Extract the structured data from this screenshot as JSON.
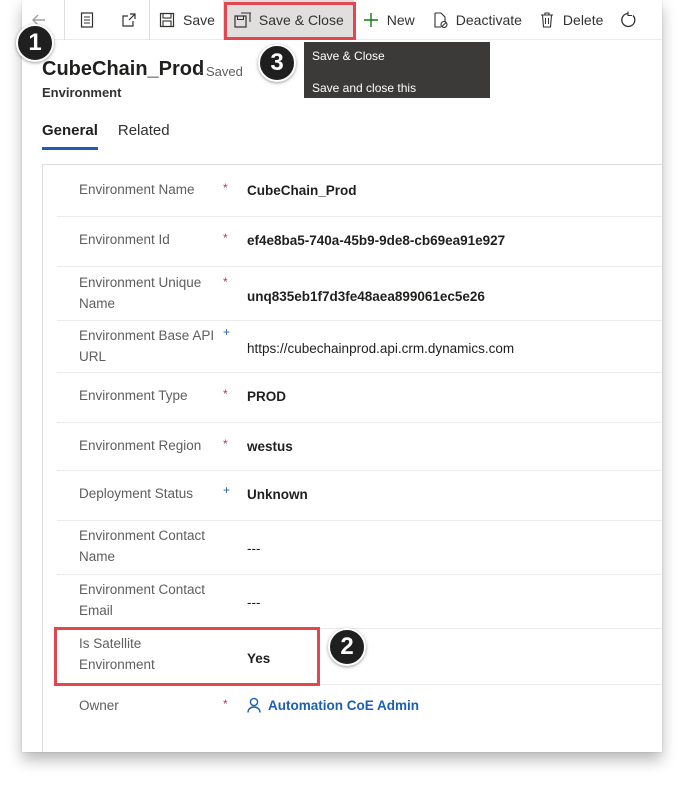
{
  "toolbar": {
    "save_label": "Save",
    "save_close_label": "Save & Close",
    "new_label": "New",
    "deactivate_label": "Deactivate",
    "delete_label": "Delete"
  },
  "record": {
    "title": "CubeChain_Prod",
    "saved_status": "- Saved",
    "entity": "Environment"
  },
  "tabs": [
    {
      "label": "General",
      "active": true
    },
    {
      "label": "Related",
      "active": false
    }
  ],
  "fields": [
    {
      "label": "Environment Name",
      "marker": "*",
      "value": "CubeChain_Prod"
    },
    {
      "label": "Environment Id",
      "marker": "*",
      "value": "ef4e8ba5-740a-45b9-9de8-cb69ea91e927"
    },
    {
      "label": "Environment Unique Name",
      "marker": "*",
      "value": "unq835eb1f7d3fe48aea899061ec5e26"
    },
    {
      "label": "Environment Base API URL",
      "marker": "+",
      "value": "https://cubechainprod.api.crm.dynamics.com"
    },
    {
      "label": "Environment Type",
      "marker": "*",
      "value": "PROD"
    },
    {
      "label": "Environment Region",
      "marker": "*",
      "value": "westus"
    },
    {
      "label": "Deployment Status",
      "marker": "+",
      "value": "Unknown"
    },
    {
      "label": "Environment Contact Name",
      "marker": "",
      "value": "---"
    },
    {
      "label": "Environment Contact Email",
      "marker": "",
      "value": "---"
    },
    {
      "label": "Is Satellite Environment",
      "marker": "",
      "value": "Yes"
    },
    {
      "label": "Owner",
      "marker": "*",
      "value": "Automation CoE Admin"
    }
  ],
  "tooltip": {
    "title": "Save & Close",
    "description": "Save and close this Environment."
  },
  "callouts": {
    "one": "1",
    "two": "2",
    "three": "3"
  },
  "colors": {
    "accent": "#1b5fb4",
    "highlight": "#e2474f",
    "required": "#c4314b",
    "tooltip_bg": "#3b3a39"
  }
}
